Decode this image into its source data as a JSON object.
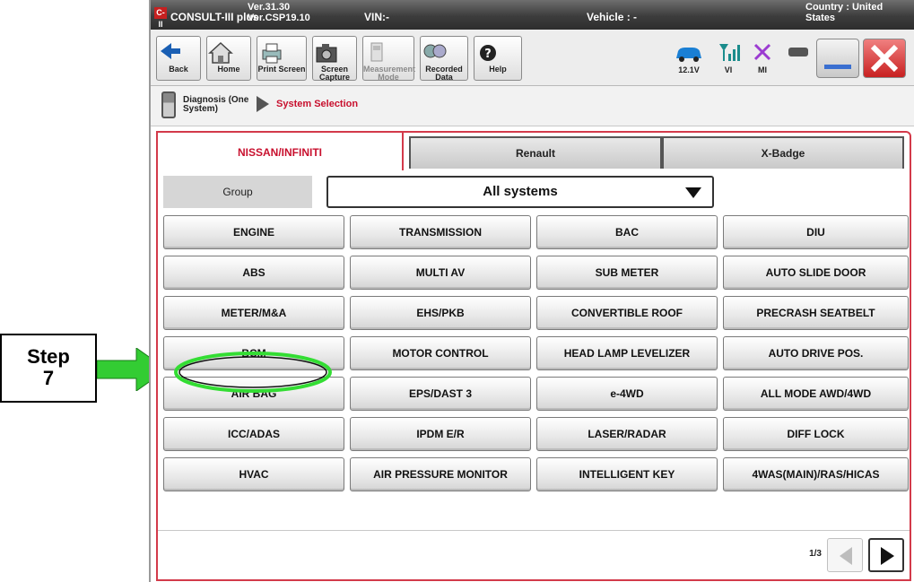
{
  "annotation": {
    "step_line1": "Step",
    "step_line2": "7",
    "arrow_color": "#33cc33",
    "highlight_color": "#33dd33"
  },
  "titlebar": {
    "logo": "C-II",
    "app_name": "CONSULT-III plus",
    "version_line1": "Ver.31.30",
    "version_line2": "Ver.CSP19.10",
    "vin": "VIN:-",
    "vehicle": "Vehicle : -",
    "country_line1": "Country : United",
    "country_line2": "States"
  },
  "toolbar": {
    "back": "Back",
    "home": "Home",
    "print_screen": "Print Screen",
    "screen_capture": [
      "Screen",
      "Capture"
    ],
    "measurement_mode": [
      "Measurement",
      "Mode"
    ],
    "recorded_data": [
      "Recorded",
      "Data"
    ],
    "help": "Help",
    "voltage": "12.1V",
    "vi": "VI",
    "mi": "MI"
  },
  "breadcrumb": {
    "item1": "Diagnosis (One System)",
    "item2": "System Selection"
  },
  "tabs": [
    "NISSAN/INFINITI",
    "Renault",
    "X-Badge"
  ],
  "group": {
    "label": "Group",
    "selected": "All systems"
  },
  "systems": [
    [
      "ENGINE",
      "TRANSMISSION",
      "BAC",
      "DIU"
    ],
    [
      "ABS",
      "MULTI AV",
      "SUB METER",
      "AUTO SLIDE DOOR"
    ],
    [
      "METER/M&A",
      "EHS/PKB",
      "CONVERTIBLE ROOF",
      "PRECRASH SEATBELT"
    ],
    [
      "BCM",
      "MOTOR CONTROL",
      "HEAD LAMP LEVELIZER",
      "AUTO DRIVE POS."
    ],
    [
      "AIR BAG",
      "EPS/DAST 3",
      "e-4WD",
      "ALL MODE AWD/4WD"
    ],
    [
      "ICC/ADAS",
      "IPDM E/R",
      "LASER/RADAR",
      "DIFF LOCK"
    ],
    [
      "HVAC",
      "AIR PRESSURE MONITOR",
      "INTELLIGENT KEY",
      "4WAS(MAIN)/RAS/HICAS"
    ]
  ],
  "pager": {
    "page": "1/3"
  },
  "colors": {
    "accent_red": "#c8102e",
    "tab_border": "#d33a4a"
  }
}
